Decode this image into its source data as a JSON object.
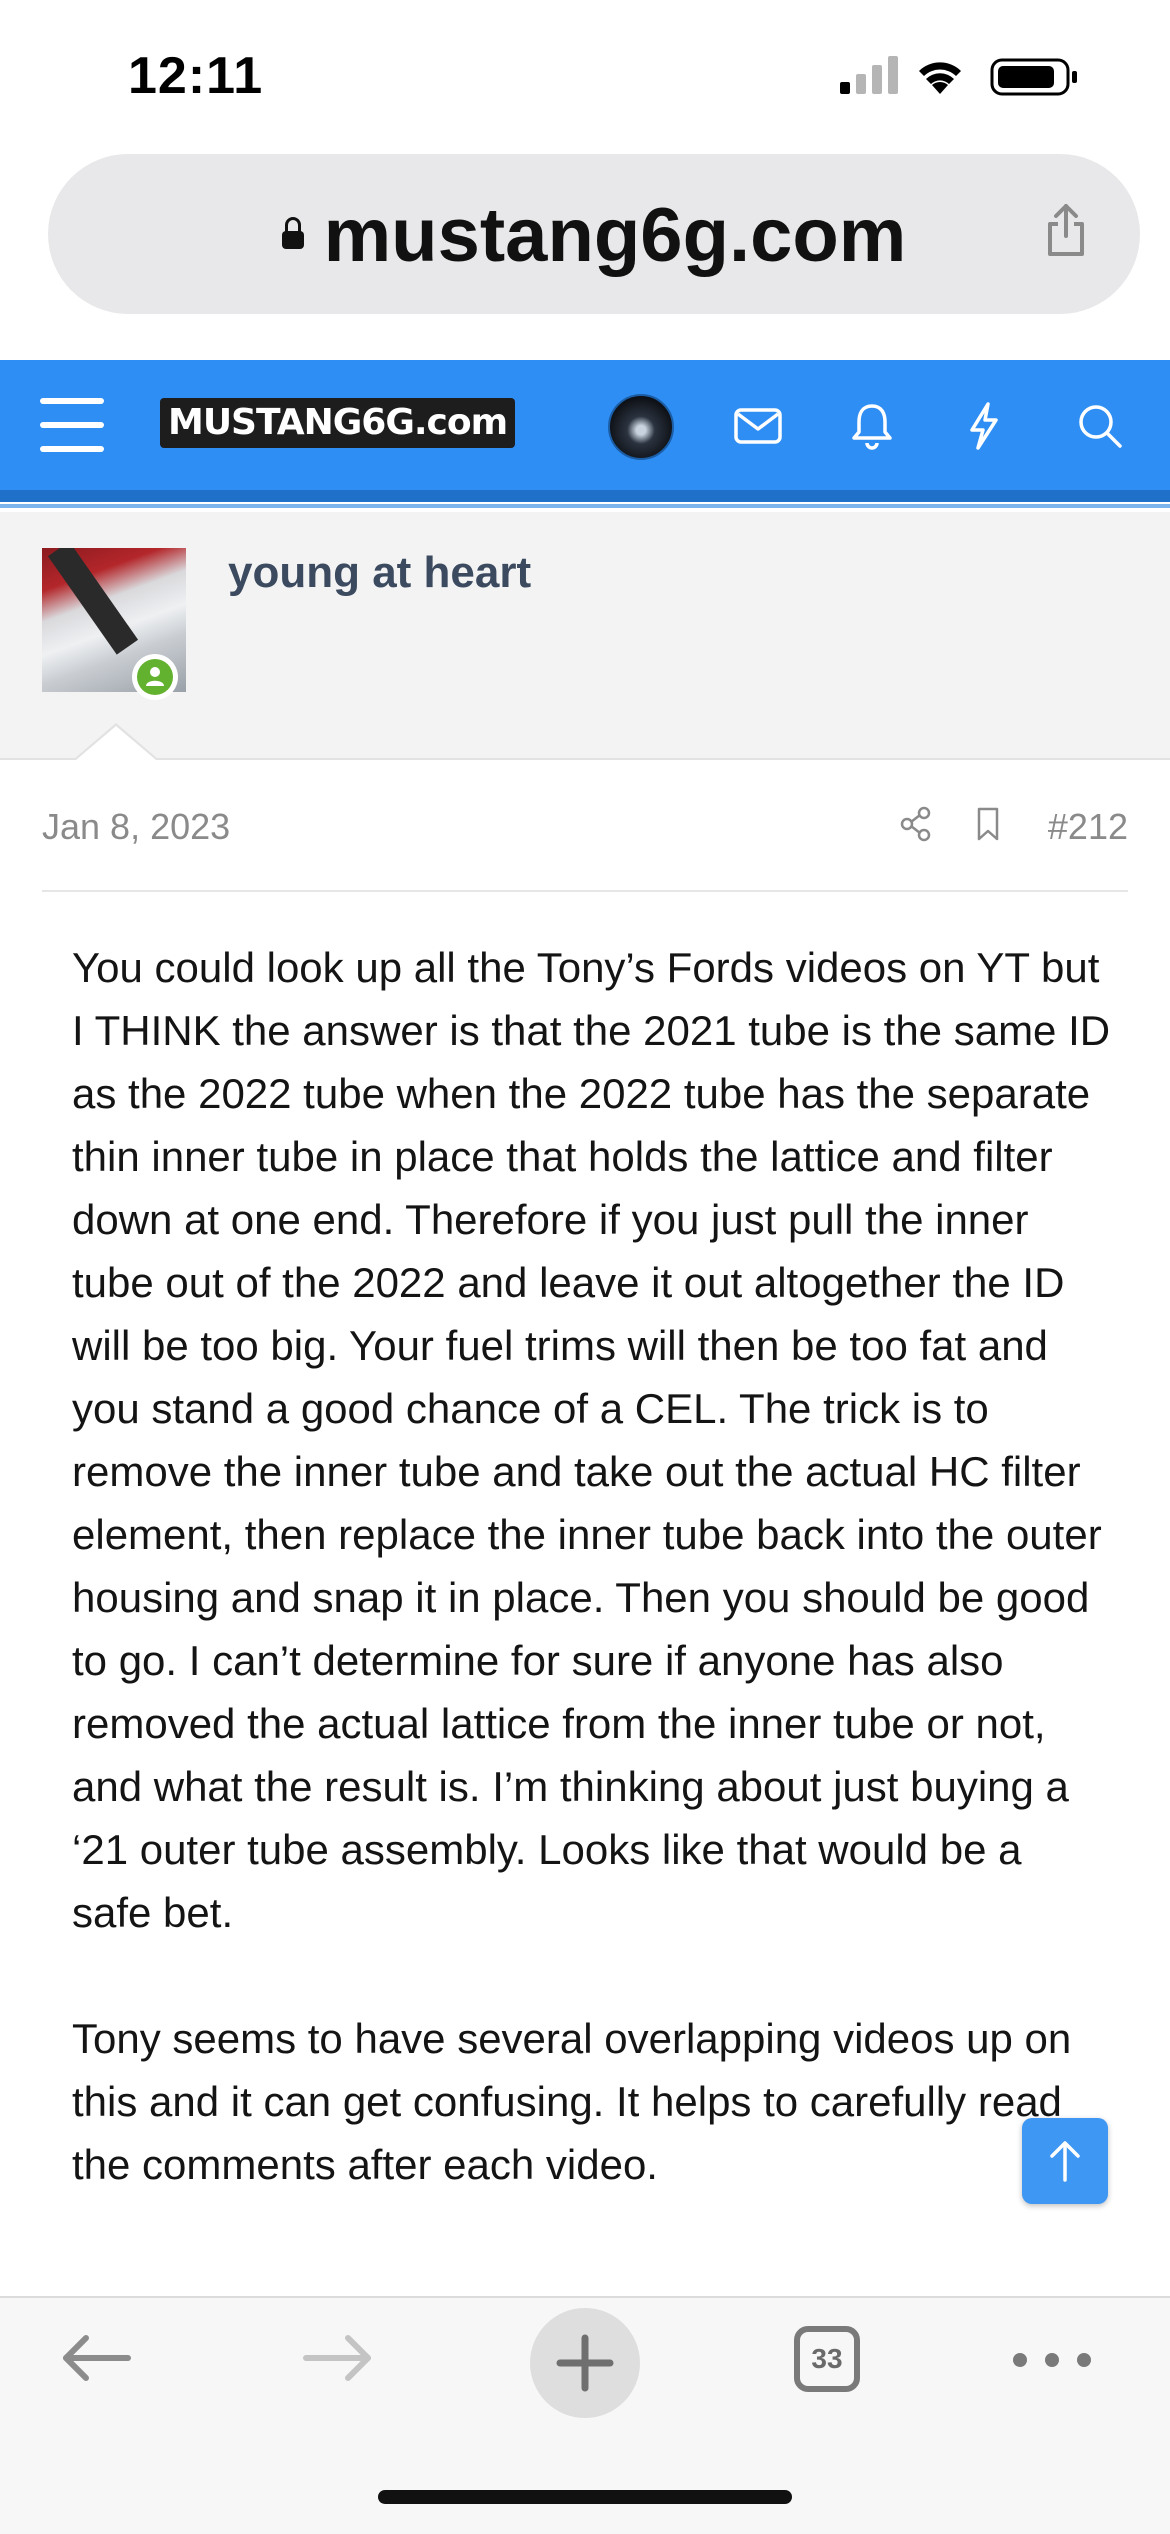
{
  "status_bar": {
    "time": "12:11"
  },
  "browser": {
    "url": "mustang6g.com"
  },
  "site_nav": {
    "logo_text": "MUSTANG6G.com"
  },
  "post": {
    "username": "young at heart",
    "date": "Jan 8, 2023",
    "post_number": "#212",
    "paragraphs": [
      "You could look up all the Tony’s Fords videos on YT but I THINK the answer is that the 2021 tube is the same ID as the 2022 tube when the 2022 tube has the separate thin inner tube in place that holds the lattice and filter down at one end. Therefore if you just pull the inner tube out of the 2022 and leave it out altogether the ID will be too big. Your fuel trims will then be too fat and you stand a good chance of a CEL. The trick is to remove the inner tube and take out the actual HC filter element, then replace the inner tube back into the outer housing and snap it in place. Then you should be good to go. I can’t determine for sure if anyone has also removed the actual lattice from the inner tube or not, and what the result is. I’m thinking about just buying a ‘21 outer tube assembly. Looks like that would be a safe bet.",
      "Tony seems to have several overlapping videos up on this and it can get confusing. It helps to carefully read the comments after each video."
    ]
  },
  "toolbar": {
    "tabs_count": "33"
  },
  "colors": {
    "nav_blue": "#2f8ef4",
    "username": "#3b4a5f",
    "online_green": "#63b22f"
  }
}
